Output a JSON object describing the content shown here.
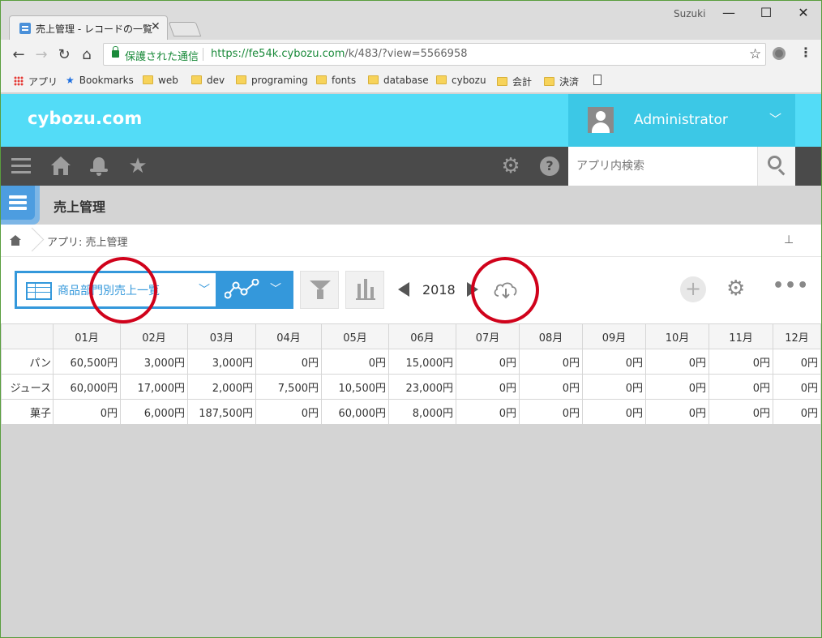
{
  "browser": {
    "tab_title": "売上管理 - レコードの一覧",
    "tab_close": "✕",
    "window_user": "Suzuki",
    "window_controls": {
      "minimize": "—",
      "maximize": "☐",
      "close": "✕"
    },
    "nav": {
      "back": "←",
      "forward": "→",
      "reload": "↻",
      "home": "⌂"
    },
    "secure_label": "保護された通信",
    "url_main": "https://fe54k.cybozu.com",
    "url_path": "/k/483/?view=5566958",
    "bookmark_star": "☆",
    "menu": "⋮",
    "bookmarks": [
      {
        "label": "アプリ",
        "icon": "apps-grid-icon"
      },
      {
        "label": "Bookmarks",
        "icon": "star-icon"
      },
      {
        "label": "web",
        "icon": "folder-icon"
      },
      {
        "label": "dev",
        "icon": "folder-icon"
      },
      {
        "label": "programing",
        "icon": "folder-icon"
      },
      {
        "label": "fonts",
        "icon": "folder-icon"
      },
      {
        "label": "database",
        "icon": "folder-icon"
      },
      {
        "label": "cybozu",
        "icon": "folder-icon"
      },
      {
        "label": "会計",
        "icon": "folder-icon"
      },
      {
        "label": "決済",
        "icon": "folder-icon"
      }
    ]
  },
  "header": {
    "logo": "cybozu.com",
    "user": "Administrator",
    "user_chevron": "﹀"
  },
  "navbar": {
    "search_placeholder": "アプリ内検索"
  },
  "app": {
    "title": "売上管理",
    "breadcrumb": "アプリ: 売上管理",
    "pin": "📌"
  },
  "viewbar": {
    "view_name": "商品部門別売上一覧",
    "view_chevron": "﹀",
    "graph_chevron": "﹀",
    "year": "2018",
    "add": "+",
    "gear": "⚙",
    "more": "•••"
  },
  "colors": {
    "header_bg": "#53dcf7",
    "navbar_bg": "#4a4a4a",
    "accent": "#3498db",
    "annotation": "#d0021b"
  },
  "table": {
    "months": [
      "01月",
      "02月",
      "03月",
      "04月",
      "05月",
      "06月",
      "07月",
      "08月",
      "09月",
      "10月",
      "11月",
      "12月"
    ],
    "rows": [
      {
        "label": "パン",
        "values": [
          "60,500円",
          "3,000円",
          "3,000円",
          "0円",
          "0円",
          "15,000円",
          "0円",
          "0円",
          "0円",
          "0円",
          "0円",
          "0円"
        ]
      },
      {
        "label": "ジュース",
        "values": [
          "60,000円",
          "17,000円",
          "2,000円",
          "7,500円",
          "10,500円",
          "23,000円",
          "0円",
          "0円",
          "0円",
          "0円",
          "0円",
          "0円"
        ]
      },
      {
        "label": "菓子",
        "values": [
          "0円",
          "6,000円",
          "187,500円",
          "0円",
          "60,000円",
          "8,000円",
          "0円",
          "0円",
          "0円",
          "0円",
          "0円",
          "0円"
        ]
      }
    ]
  }
}
